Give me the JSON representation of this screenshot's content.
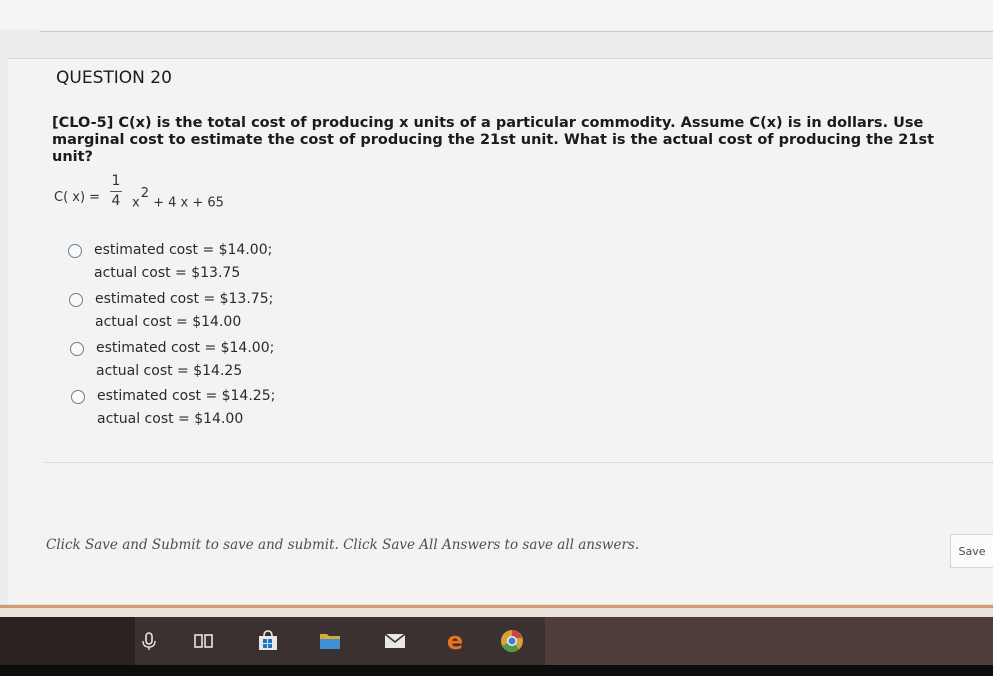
{
  "question": {
    "number_label": "QUESTION 20",
    "text": "[CLO-5] C(x) is the total cost of producing x units of a particular commodity. Assume C(x) is in dollars. Use marginal cost to estimate the cost of producing the 21st unit. What is the actual cost of producing the 21st unit?",
    "formula": {
      "lhs": "C( x) =",
      "numerator": "1",
      "denominator": "4",
      "var": "x",
      "exponent": "2",
      "rest": "+ 4 x + 65"
    },
    "options": [
      {
        "line1": "estimated cost = $14.00;",
        "line2": "actual cost = $13.75"
      },
      {
        "line1": "estimated cost = $13.75;",
        "line2": "actual cost = $14.00"
      },
      {
        "line1": "estimated cost = $14.00;",
        "line2": "actual cost = $14.25"
      },
      {
        "line1": "estimated cost = $14.25;",
        "line2": "actual cost = $14.00"
      }
    ]
  },
  "footer": {
    "instruction": "Click Save and Submit to save and submit. Click Save All Answers to save all answers.",
    "save_label": "Save"
  },
  "taskbar": {
    "icons": [
      "microphone-icon",
      "task-view-icon",
      "store-icon",
      "file-explorer-icon",
      "mail-icon",
      "edge-icon",
      "chrome-icon"
    ]
  },
  "colors": {
    "accent_radio": "#6a7e9c",
    "taskbar": "#3b3130",
    "edge_orange": "#e8741c"
  }
}
